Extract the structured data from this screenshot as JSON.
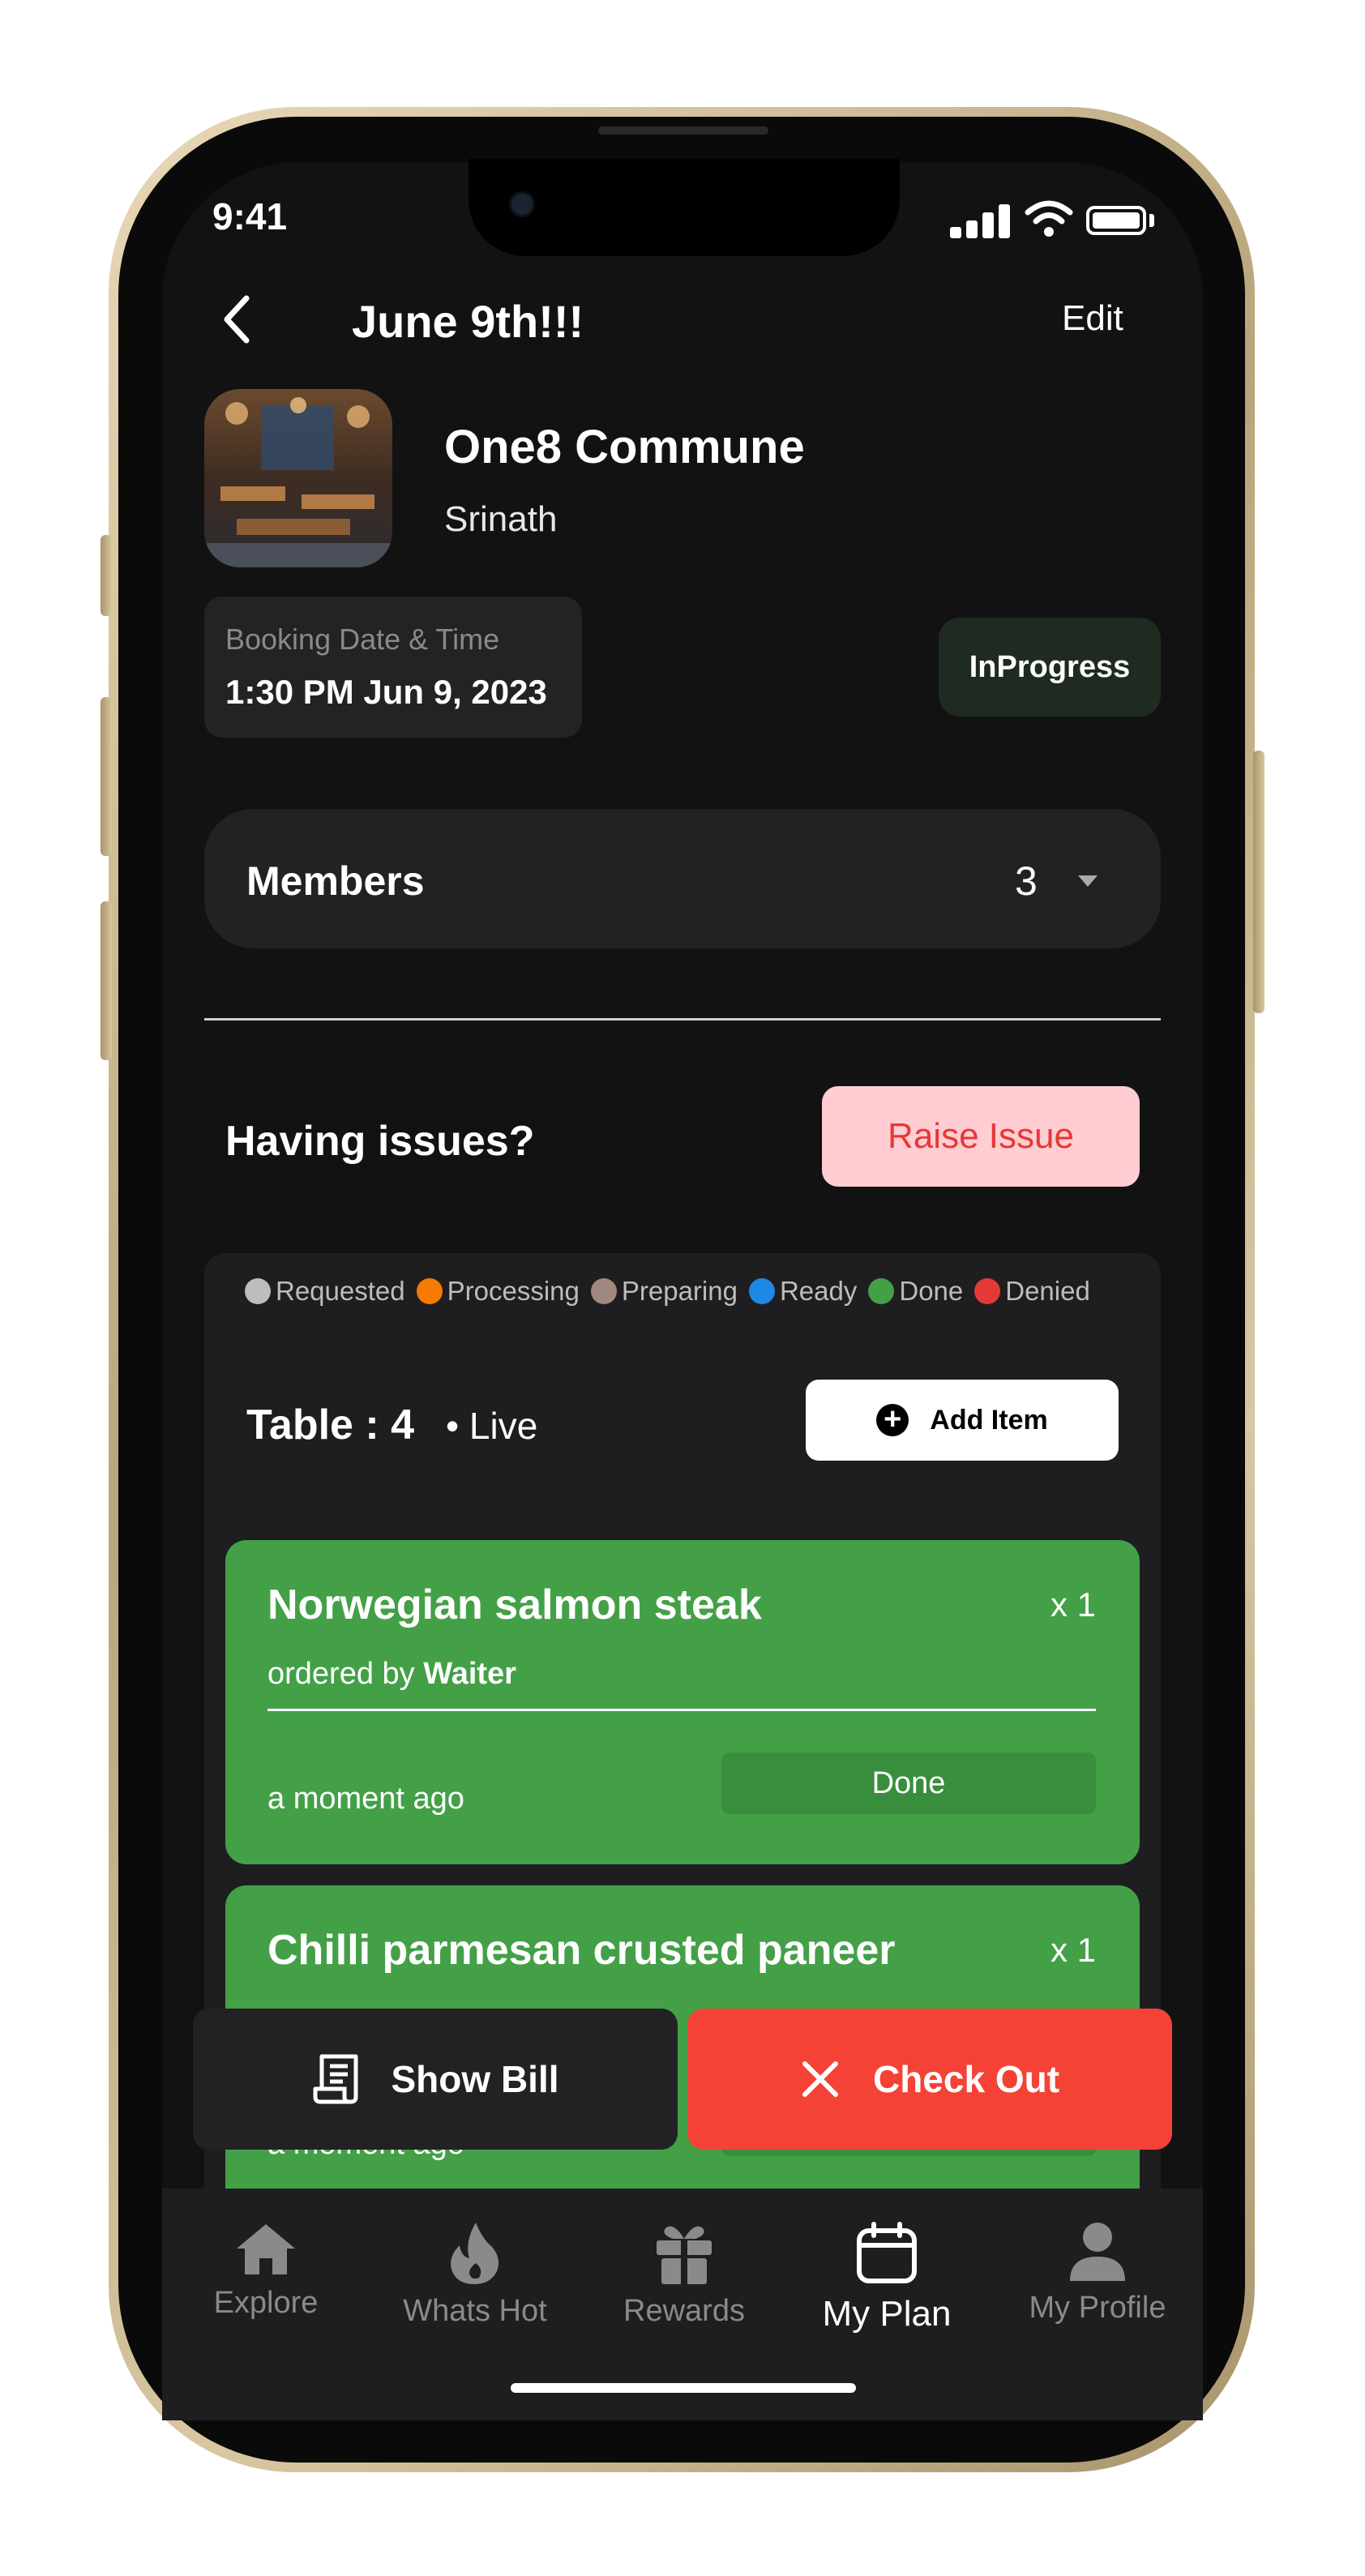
{
  "status_bar": {
    "time": "9:41"
  },
  "header": {
    "title": "June 9th!!!",
    "edit_label": "Edit"
  },
  "restaurant": {
    "name": "One8 Commune",
    "owner": "Srinath"
  },
  "booking": {
    "label": "Booking Date & Time",
    "value": "1:30 PM Jun 9, 2023"
  },
  "status": {
    "label": "InProgress"
  },
  "members": {
    "label": "Members",
    "count": "3"
  },
  "issues": {
    "label": "Having issues?",
    "button_label": "Raise Issue"
  },
  "legend": [
    {
      "label": "Requested",
      "color": "#bdbdbd"
    },
    {
      "label": "Processing",
      "color": "#f57c00"
    },
    {
      "label": "Preparing",
      "color": "#a1887f"
    },
    {
      "label": "Ready",
      "color": "#1e88e5"
    },
    {
      "label": "Done",
      "color": "#43a047"
    },
    {
      "label": "Denied",
      "color": "#e53935"
    }
  ],
  "table": {
    "label": "Table : 4",
    "live_label": "• Live",
    "add_item_label": "Add Item"
  },
  "orders": [
    {
      "name": "Norwegian salmon steak",
      "qty": "x 1",
      "ordered_by_prefix": "ordered by",
      "ordered_by": "Waiter",
      "time": "a moment ago",
      "status": "Done"
    },
    {
      "name": "Chilli parmesan crusted paneer",
      "qty": "x 1",
      "time": "a moment ago"
    }
  ],
  "actions": {
    "show_bill_label": "Show Bill",
    "check_out_label": "Check Out"
  },
  "tabbar": {
    "items": [
      {
        "label": "Explore",
        "icon": "home-icon"
      },
      {
        "label": "Whats Hot",
        "icon": "flame-icon"
      },
      {
        "label": "Rewards",
        "icon": "gift-icon"
      },
      {
        "label": "My Plan",
        "icon": "calendar-icon"
      },
      {
        "label": "My Profile",
        "icon": "person-icon"
      }
    ],
    "active": "My Plan"
  },
  "colors": {
    "background": "#121212",
    "done_green": "#43a047",
    "danger_red": "#f44336",
    "raise_pink": "#ffcdd2"
  }
}
